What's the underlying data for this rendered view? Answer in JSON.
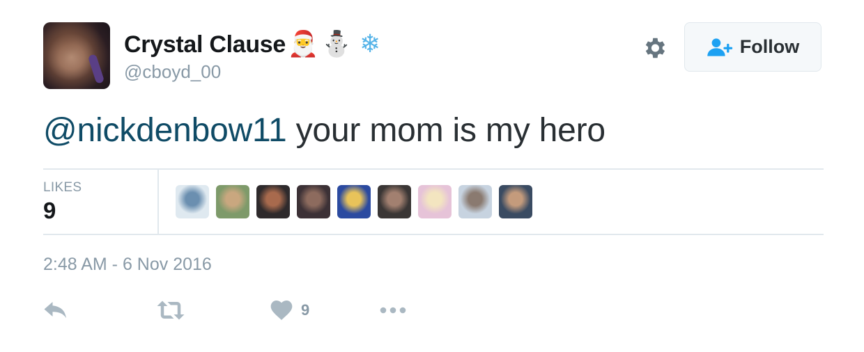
{
  "user": {
    "display_name": "Crystal Clause",
    "emojis": [
      {
        "name": "santa-emoji",
        "glyph": "🎅"
      },
      {
        "name": "snowman-emoji",
        "glyph": "⛄"
      },
      {
        "name": "snowflake-emoji",
        "glyph": "❄"
      }
    ],
    "handle": "@cboyd_00"
  },
  "follow_button": {
    "label": "Follow",
    "icon": "add-user-icon",
    "color": "#1da1f2"
  },
  "settings": {
    "icon": "gear-icon"
  },
  "tweet": {
    "mention": "@nickdenbow11",
    "text": " your mom is my hero"
  },
  "stats": {
    "likes_label": "LIKES",
    "likes_count": "9",
    "likers": [
      {
        "name": "liker-avatar-1",
        "bg": "#dfe9f0",
        "fg": "#6b8fb0"
      },
      {
        "name": "liker-avatar-2",
        "bg": "#7e9a6a",
        "fg": "#c9a77f"
      },
      {
        "name": "liker-avatar-3",
        "bg": "#2e2a2c",
        "fg": "#a86a4d"
      },
      {
        "name": "liker-avatar-4",
        "bg": "#3c3136",
        "fg": "#8d6b5e"
      },
      {
        "name": "liker-avatar-5",
        "bg": "#2b4aa0",
        "fg": "#e8c35a"
      },
      {
        "name": "liker-avatar-6",
        "bg": "#3a3635",
        "fg": "#a28070"
      },
      {
        "name": "liker-avatar-7",
        "bg": "#e6c3d8",
        "fg": "#f3e5c0"
      },
      {
        "name": "liker-avatar-8",
        "bg": "#c7d3e0",
        "fg": "#8a7a70"
      },
      {
        "name": "liker-avatar-9",
        "bg": "#3a4b62",
        "fg": "#c49b7c"
      }
    ]
  },
  "timestamp": "2:48 AM - 6 Nov 2016",
  "actions": {
    "reply": {
      "icon": "reply-icon"
    },
    "retweet": {
      "icon": "retweet-icon"
    },
    "like": {
      "icon": "heart-icon",
      "count": "9"
    },
    "more": {
      "icon": "more-icon"
    }
  },
  "colors": {
    "mention": "#0f4b66",
    "muted": "#8899a6",
    "text": "#292f33",
    "divider": "#e1e8ed",
    "icon": "#aab8c2"
  }
}
